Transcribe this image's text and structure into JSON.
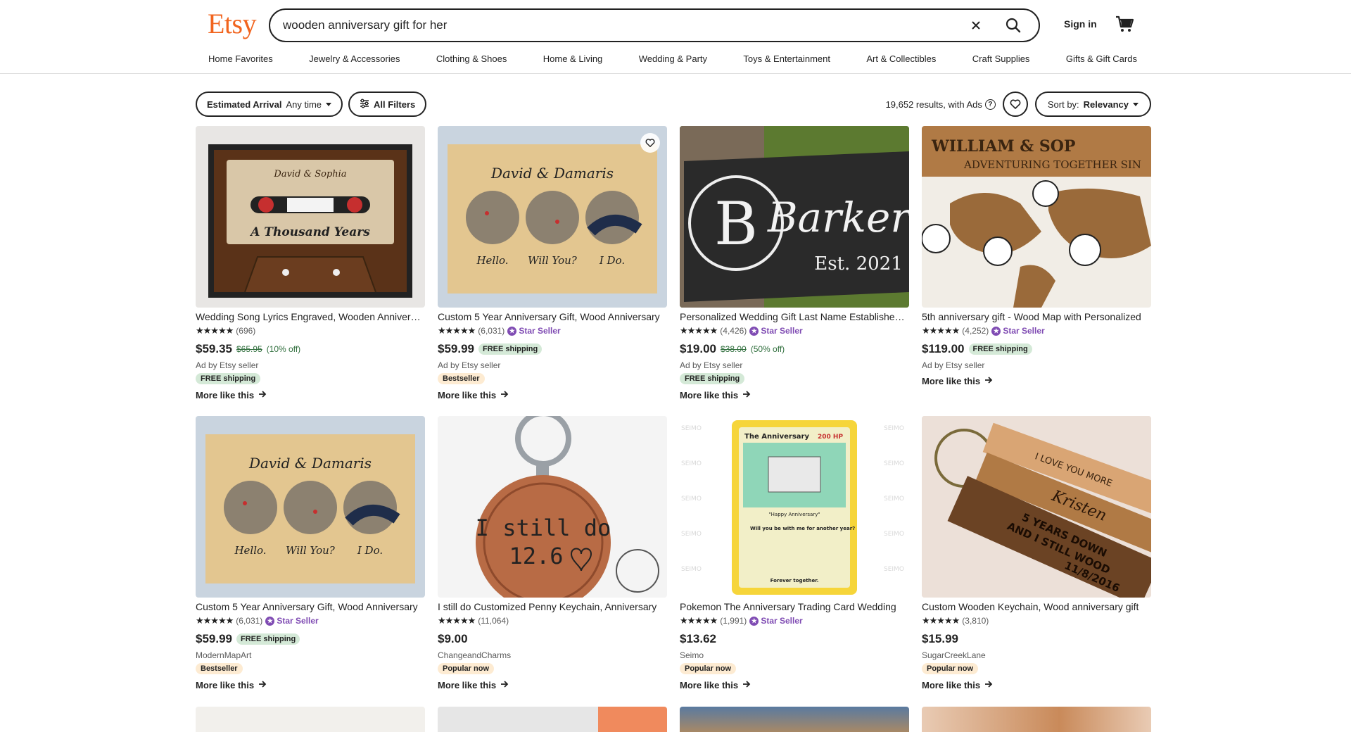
{
  "header": {
    "logo": "Etsy",
    "search_value": "wooden anniversary gift for her",
    "sign_in": "Sign in"
  },
  "categories": [
    "Home Favorites",
    "Jewelry & Accessories",
    "Clothing & Shoes",
    "Home & Living",
    "Wedding & Party",
    "Toys & Entertainment",
    "Art & Collectibles",
    "Craft Supplies",
    "Gifts & Gift Cards"
  ],
  "filters": {
    "arrival_label": "Estimated Arrival",
    "arrival_value": "Any time",
    "all_filters": "All Filters",
    "results": "19,652 results, with Ads",
    "sort_label": "Sort by:",
    "sort_value": "Relevancy"
  },
  "colors": {
    "brand": "#f1641e",
    "star_seller": "#7f4bb3",
    "sale_green": "#2f6e3c"
  },
  "listings": [
    {
      "title": "Wedding Song Lyrics Engraved, Wooden Anniversary Gift",
      "stars": "★★★★★",
      "reviews": "(696)",
      "star_seller": "",
      "price": "$59.35",
      "original": "$65.95",
      "discount": "(10% off)",
      "inline_ship": "",
      "shop": "Ad by Etsy seller",
      "badge": "FREE shipping",
      "more": "More like this"
    },
    {
      "title": "Custom 5 Year Anniversary Gift, Wood Anniversary",
      "stars": "★★★★★",
      "reviews": "(6,031)",
      "star_seller": "Star Seller",
      "price": "$59.99",
      "original": "",
      "discount": "",
      "inline_ship": "FREE shipping",
      "shop": "Ad by Etsy seller",
      "badge": "Bestseller",
      "more": "More like this"
    },
    {
      "title": "Personalized Wedding Gift Last Name Established Sign",
      "stars": "★★★★★",
      "reviews": "(4,426)",
      "star_seller": "Star Seller",
      "price": "$19.00",
      "original": "$38.00",
      "discount": "(50% off)",
      "inline_ship": "",
      "shop": "Ad by Etsy seller",
      "badge": "FREE shipping",
      "more": "More like this"
    },
    {
      "title": "5th anniversary gift - Wood Map with Personalized",
      "stars": "★★★★★",
      "reviews": "(4,252)",
      "star_seller": "Star Seller",
      "price": "$119.00",
      "original": "",
      "discount": "",
      "inline_ship": "FREE shipping",
      "shop": "Ad by Etsy seller",
      "badge": "",
      "more": "More like this"
    },
    {
      "title": "Custom 5 Year Anniversary Gift, Wood Anniversary",
      "stars": "★★★★★",
      "reviews": "(6,031)",
      "star_seller": "Star Seller",
      "price": "$59.99",
      "original": "",
      "discount": "",
      "inline_ship": "FREE shipping",
      "shop": "ModernMapArt",
      "badge": "Bestseller",
      "more": "More like this"
    },
    {
      "title": "I still do Customized Penny Keychain, Anniversary",
      "stars": "★★★★★",
      "reviews": "(11,064)",
      "star_seller": "",
      "price": "$9.00",
      "original": "",
      "discount": "",
      "inline_ship": "",
      "shop": "ChangeandCharms",
      "badge": "Popular now",
      "more": "More like this"
    },
    {
      "title": "Pokemon The Anniversary Trading Card Wedding",
      "stars": "★★★★★",
      "reviews": "(1,991)",
      "star_seller": "Star Seller",
      "price": "$13.62",
      "original": "",
      "discount": "",
      "inline_ship": "",
      "shop": "Seimo",
      "badge": "Popular now",
      "more": "More like this"
    },
    {
      "title": "Custom Wooden Keychain, Wood anniversary gift",
      "stars": "★★★★★",
      "reviews": "(3,810)",
      "star_seller": "",
      "price": "$15.99",
      "original": "",
      "discount": "",
      "inline_ship": "",
      "shop": "SugarCreekLane",
      "badge": "Popular now",
      "more": "More like this"
    }
  ],
  "art": {
    "cassette_names": "David & Sophia",
    "cassette_song": "A Thousand Years",
    "map_names": "David & Damaris",
    "map_hello": "Hello.",
    "map_willyou": "Will You?",
    "map_ido": "I Do.",
    "sign_letter": "B",
    "sign_name": "Barker",
    "sign_est": "Est. 2021",
    "world_title": "WILLIAM & SOP",
    "world_sub": "ADVENTURING TOGETHER SIN",
    "penny_text1": "I still do",
    "penny_text2": "12.6",
    "card_title": "The Anniversary",
    "card_hp": "200 HP",
    "card_caption": "\"Happy Anniversary\"",
    "card_move": "Will you be with me for another year?",
    "card_footer": "Forever together.",
    "card_watermark": "SEIMO",
    "key_text1": "I LOVE YOU MORE",
    "key_text2": "Kristen",
    "key_text3": "5 YEARS DOWN",
    "key_text4": "AND I STILL WOOD",
    "key_text5": "11/8/2016"
  }
}
